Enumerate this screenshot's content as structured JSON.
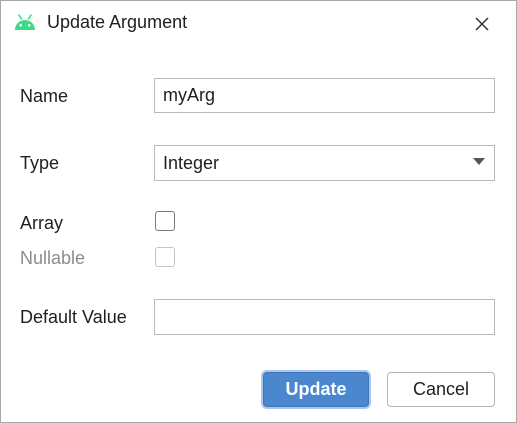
{
  "window": {
    "title": "Update Argument",
    "app_icon": "android-icon",
    "close_icon": "close-icon"
  },
  "form": {
    "name": {
      "label": "Name",
      "value": "myArg"
    },
    "type": {
      "label": "Type",
      "selected": "Integer"
    },
    "array": {
      "label": "Array",
      "checked": false
    },
    "nullable": {
      "label": "Nullable",
      "checked": false,
      "disabled": true
    },
    "default_value": {
      "label": "Default Value",
      "value": ""
    }
  },
  "buttons": {
    "update_label": "Update",
    "cancel_label": "Cancel"
  },
  "colors": {
    "accent": "#4a87cf",
    "android_green": "#3ddc84"
  }
}
